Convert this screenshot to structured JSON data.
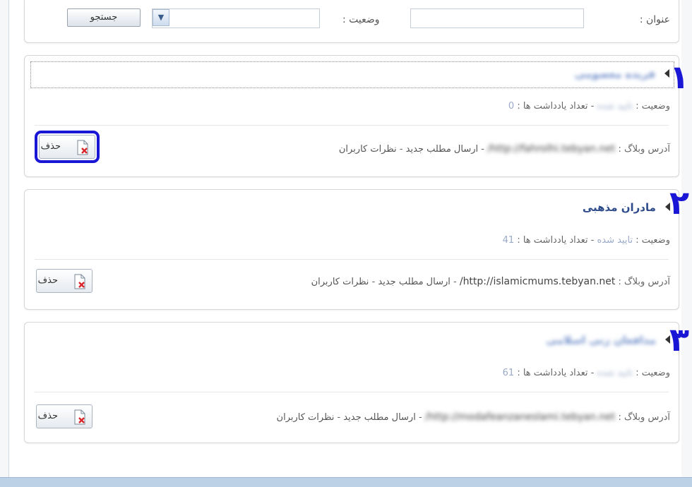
{
  "search": {
    "title_label": "عنوان :",
    "status_label": "وضعیت :",
    "search_button": "جستجو"
  },
  "labels": {
    "status_prefix": "وضعیت :",
    "notes_count_label": "تعداد یادداشت ها :",
    "separator": "-",
    "address_prefix": "آدرس وبلاگ :",
    "new_post": "ارسال مطلب جدید",
    "user_comments": "نظرات کاربران",
    "delete_button": "حذف"
  },
  "blogs": [
    {
      "name": "فریده معصومی",
      "status": "تایید شده",
      "notes_count": "0",
      "url": "http://fahrolhi.tebyan.net/",
      "marker": "۱"
    },
    {
      "name": "مادران مذهبی",
      "status": "تایید شده",
      "notes_count": "41",
      "url": "http://islamicmums.tebyan.net/",
      "marker": "۲"
    },
    {
      "name": "مدافعان زنی اسلامی",
      "status": "تایید شده",
      "notes_count": "61",
      "url": "http://modafeanzaneslami.tebyan.net/",
      "marker": "۳"
    }
  ],
  "colors": {
    "annotation": "#1a16d6",
    "blog_title": "#2d4a8a",
    "status_value": "#9aa9c7"
  }
}
